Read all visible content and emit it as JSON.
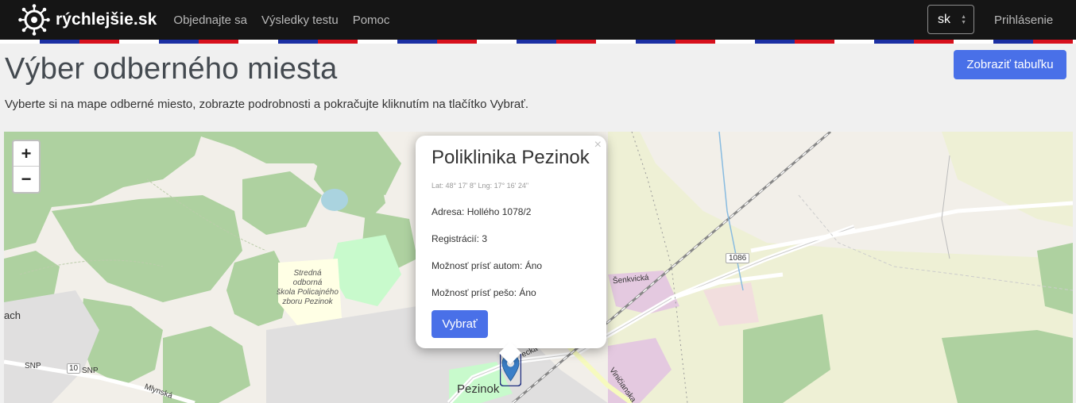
{
  "nav": {
    "brand": "rýchlejšie.sk",
    "links": [
      "Objednajte sa",
      "Výsledky testu",
      "Pomoc"
    ],
    "language": "sk",
    "login": "Prihlásenie"
  },
  "header": {
    "title": "Výber odberného miesta",
    "subtitle": "Vyberte si na mape odberné miesto, zobrazte podrobnosti a pokračujte kliknutím na tlačítko Vybrať.",
    "table_button": "Zobraziť tabuľku"
  },
  "map": {
    "zoom_in": "+",
    "zoom_out": "−",
    "labels": {
      "school": [
        "Stredná",
        "odborná",
        "škola Policajného",
        "zboru Pezinok"
      ],
      "town": "Pezinok",
      "road_number": "1086",
      "street_senkvicka": "Šenkvická",
      "left_edge": "ach",
      "snp1": "SNP",
      "snp2": "SNP",
      "road_10": "10",
      "mlynska": "Mlynská",
      "vinicianska": "Viničianska",
      "street_mid": "ecká"
    }
  },
  "popup": {
    "title": "Poliklinika Pezinok",
    "coords": "Lat: 48° 17' 8\" Lng: 17° 16' 24\"",
    "address": "Adresa: Hollého 1078/2",
    "registrations": "Registrácií: 3",
    "car": "Možnosť prísť autom: Áno",
    "walk": "Možnosť prísť pešo: Áno",
    "select_button": "Vybrať",
    "close": "×"
  }
}
